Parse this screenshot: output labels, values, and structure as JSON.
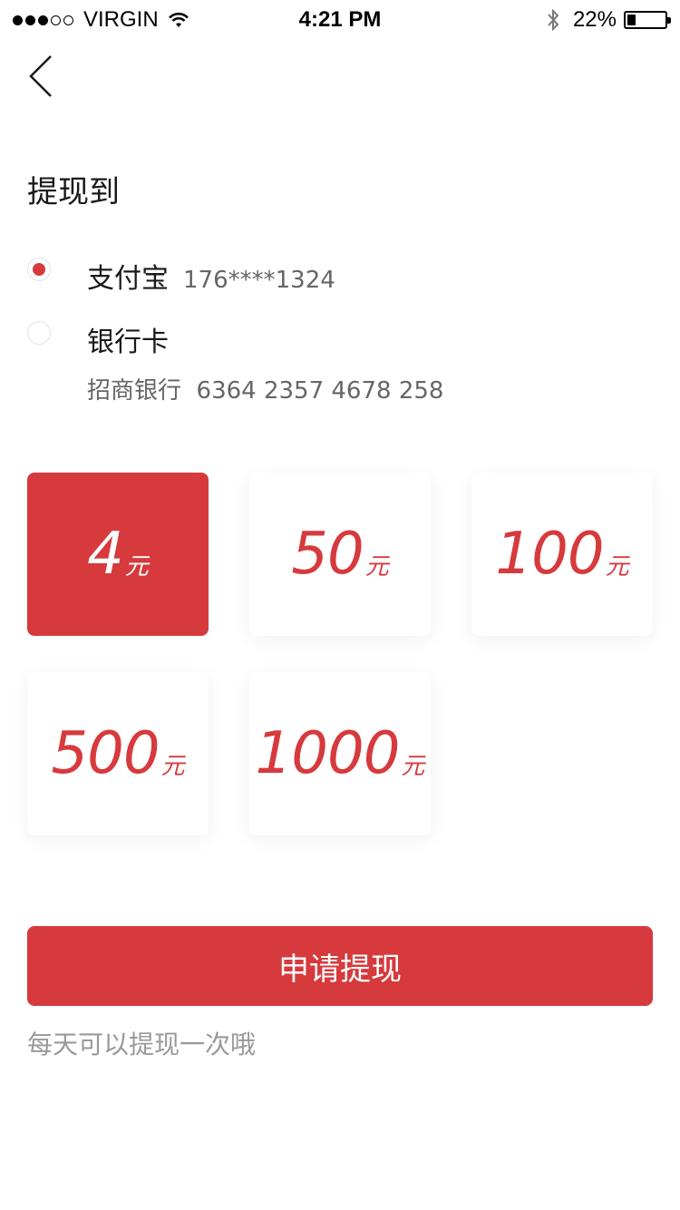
{
  "status_bar": {
    "carrier": "VIRGIN",
    "time": "4:21 PM",
    "battery": "22%",
    "battery_level": 0.22
  },
  "header": {
    "back_icon": "chevron-left-icon"
  },
  "withdraw_to": {
    "title": "提现到",
    "options": [
      {
        "name": "支付宝",
        "account": "176****1324",
        "selected": true
      },
      {
        "name": "银行卡",
        "sub": "招商银行  6364 2357 4678 258",
        "selected": false
      }
    ]
  },
  "amounts": [
    {
      "value": "4",
      "unit": "元",
      "selected": true
    },
    {
      "value": "50",
      "unit": "元",
      "selected": false
    },
    {
      "value": "100",
      "unit": "元",
      "selected": false
    },
    {
      "value": "500",
      "unit": "元",
      "selected": false
    },
    {
      "value": "1000",
      "unit": "元",
      "selected": false
    }
  ],
  "submit": {
    "label": "申请提现"
  },
  "hint": "每天可以提现一次哦",
  "colors": {
    "accent": "#d63a3d",
    "secondary_text": "#666666",
    "hint_text": "#999999"
  }
}
